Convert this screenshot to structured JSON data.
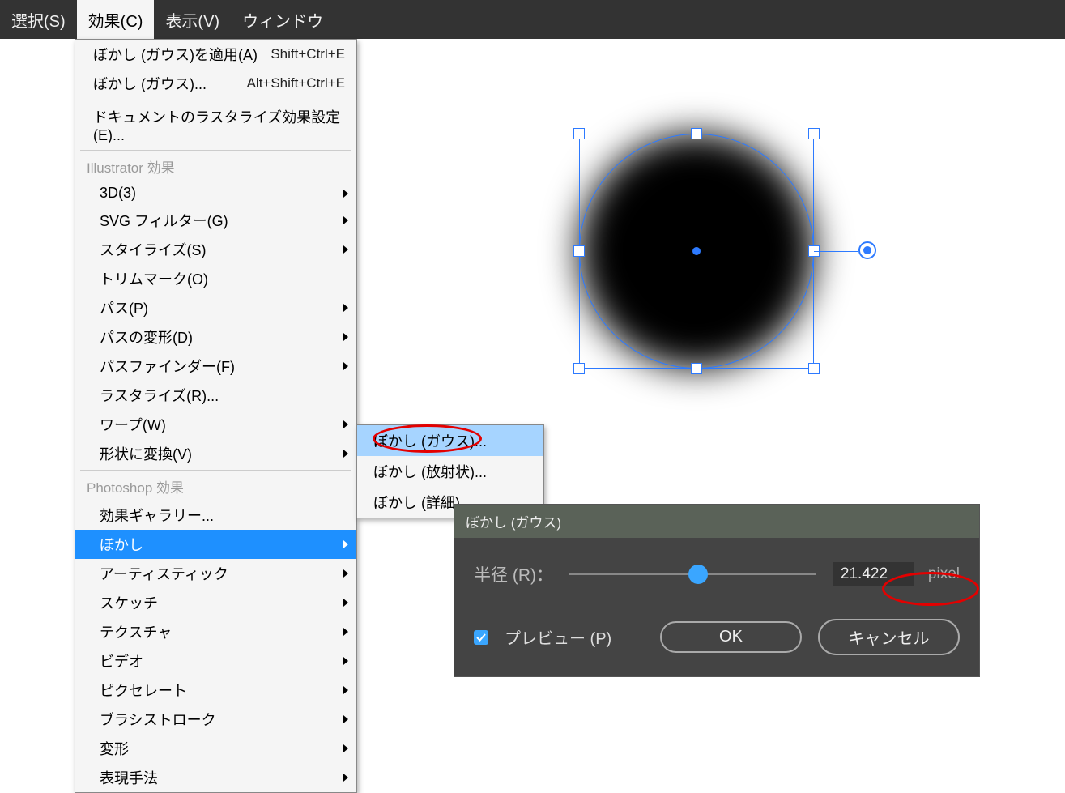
{
  "menubar": {
    "select": "選択(S)",
    "effect": "効果(C)",
    "view": "表示(V)",
    "window": "ウィンドウ"
  },
  "menu": {
    "apply_last": "ぼかし (ガウス)を適用(A)",
    "apply_last_sc": "Shift+Ctrl+E",
    "last": "ぼかし (ガウス)...",
    "last_sc": "Alt+Shift+Ctrl+E",
    "doc_raster": "ドキュメントのラスタライズ効果設定(E)...",
    "ill_header": "Illustrator 効果",
    "three_d": "3D(3)",
    "svg_filter": "SVG フィルター(G)",
    "stylize": "スタイライズ(S)",
    "trim": "トリムマーク(O)",
    "path": "パス(P)",
    "path_deform": "パスの変形(D)",
    "pathfinder": "パスファインダー(F)",
    "rasterize": "ラスタライズ(R)...",
    "warp": "ワープ(W)",
    "convert_shape": "形状に変換(V)",
    "ps_header": "Photoshop 効果",
    "effect_gallery": "効果ギャラリー...",
    "blur": "ぼかし",
    "artistic": "アーティスティック",
    "sketch": "スケッチ",
    "texture": "テクスチャ",
    "video": "ビデオ",
    "pixelate": "ピクセレート",
    "brush": "ブラシストローク",
    "distort": "変形",
    "expression": "表現手法"
  },
  "submenu": {
    "gauss": "ぼかし (ガウス)...",
    "radial": "ぼかし (放射状)...",
    "detail": "ぼかし (詳細)..."
  },
  "dialog": {
    "title": "ぼかし (ガウス)",
    "radius_label": "半径 (R)：",
    "radius_value": "21.422",
    "unit": "pixel",
    "preview": "プレビュー (P)",
    "ok": "OK",
    "cancel": "キャンセル"
  }
}
